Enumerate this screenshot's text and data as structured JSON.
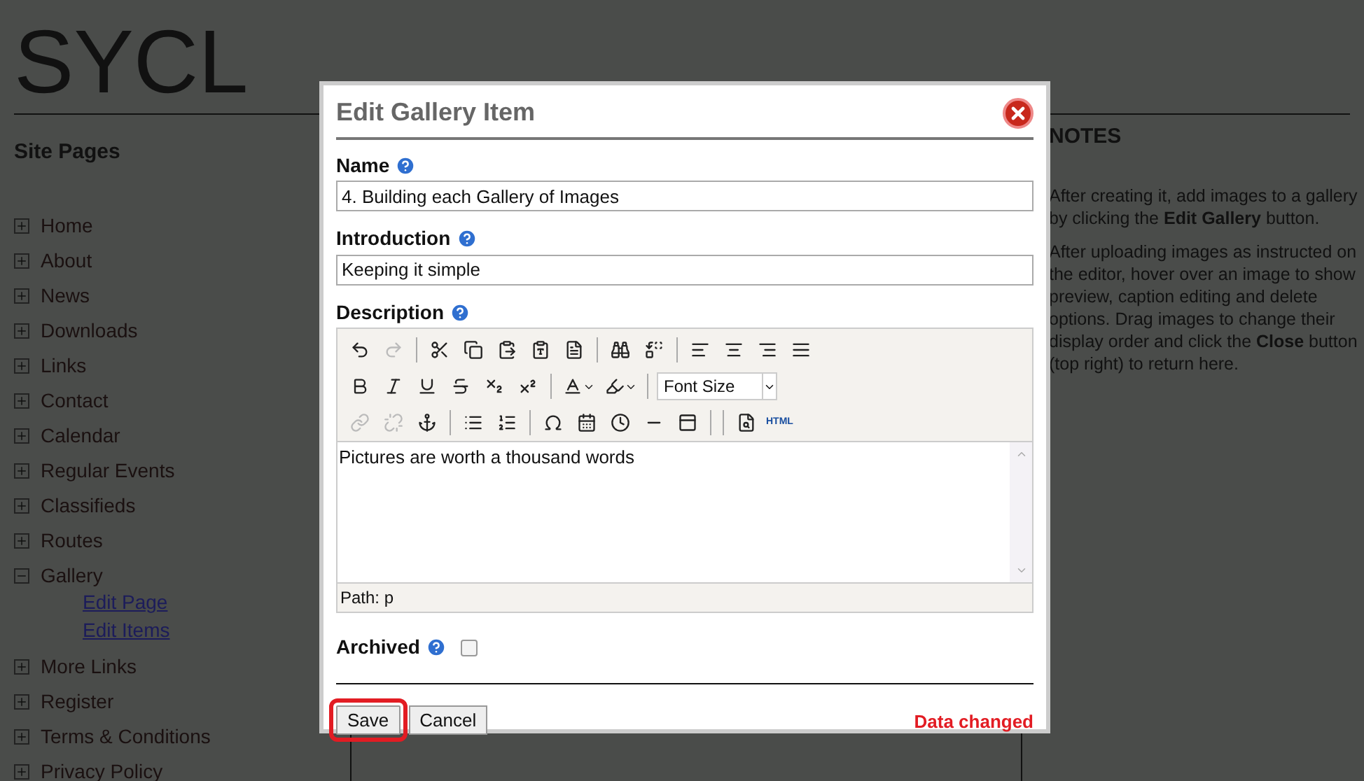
{
  "site_title": "SYCL",
  "sidebar": {
    "heading": "Site Pages",
    "items": [
      {
        "label": "Home",
        "expanded": false
      },
      {
        "label": "About",
        "expanded": false
      },
      {
        "label": "News",
        "expanded": false
      },
      {
        "label": "Downloads",
        "expanded": false
      },
      {
        "label": "Links",
        "expanded": false
      },
      {
        "label": "Contact",
        "expanded": false
      },
      {
        "label": "Calendar",
        "expanded": false
      },
      {
        "label": "Regular Events",
        "expanded": false
      },
      {
        "label": "Classifieds",
        "expanded": false
      },
      {
        "label": "Routes",
        "expanded": false
      },
      {
        "label": "Gallery",
        "expanded": true,
        "children": [
          {
            "label": "Edit Page"
          },
          {
            "label": "Edit Items"
          }
        ]
      },
      {
        "label": "More Links",
        "expanded": false
      },
      {
        "label": "Register",
        "expanded": false
      },
      {
        "label": "Terms & Conditions",
        "expanded": false
      },
      {
        "label": "Privacy Policy",
        "expanded": false
      }
    ]
  },
  "notes": {
    "heading": "NOTES",
    "paragraphs": [
      "After creating it, add images to a gallery by clicking the **Edit Gallery** button.",
      "After uploading images as instructed on the editor, hover over an image to show preview, caption editing and delete options. Drag images to change their display order and click the **Close** button (top right) to return here."
    ]
  },
  "dialog": {
    "title": "Edit Gallery Item",
    "name": {
      "label": "Name",
      "value": "4. Building each Gallery of Images"
    },
    "introduction": {
      "label": "Introduction",
      "value": "Keeping it simple"
    },
    "description": {
      "label": "Description",
      "toolbar": [
        [
          {
            "kind": "button",
            "disabled": false
          },
          {
            "kind": "button",
            "disabled": true
          },
          {
            "kind": "separator"
          },
          {
            "kind": "button",
            "disabled": false
          },
          {
            "kind": "button",
            "disabled": false
          },
          {
            "kind": "button",
            "disabled": false
          },
          {
            "kind": "button",
            "disabled": false
          },
          {
            "kind": "button",
            "disabled": false
          },
          {
            "kind": "separator"
          },
          {
            "kind": "button",
            "disabled": false
          },
          {
            "kind": "button",
            "disabled": false
          },
          {
            "kind": "separator"
          },
          {
            "kind": "button",
            "disabled": false
          },
          {
            "kind": "button",
            "disabled": false
          },
          {
            "kind": "button",
            "disabled": false
          },
          {
            "kind": "button",
            "disabled": false
          }
        ],
        [
          {
            "kind": "button",
            "disabled": false
          },
          {
            "kind": "button",
            "disabled": false
          },
          {
            "kind": "button",
            "disabled": false
          },
          {
            "kind": "button",
            "disabled": false
          },
          {
            "kind": "button",
            "disabled": false
          },
          {
            "kind": "button",
            "disabled": false
          },
          {
            "kind": "separator"
          },
          {
            "kind": "split",
            "disabled": false
          },
          {
            "kind": "split",
            "disabled": false
          },
          {
            "kind": "separator"
          },
          {
            "kind": "select",
            "text": "Font Size"
          }
        ],
        [
          {
            "kind": "button",
            "disabled": true
          },
          {
            "kind": "button",
            "disabled": true
          },
          {
            "kind": "button",
            "disabled": false
          },
          {
            "kind": "separator"
          },
          {
            "kind": "button",
            "disabled": false
          },
          {
            "kind": "button",
            "disabled": false
          },
          {
            "kind": "separator"
          },
          {
            "kind": "button",
            "disabled": false
          },
          {
            "kind": "button",
            "disabled": false
          },
          {
            "kind": "button",
            "disabled": false
          },
          {
            "kind": "button",
            "disabled": false
          },
          {
            "kind": "button",
            "disabled": false
          },
          {
            "kind": "separator"
          },
          {
            "kind": "separator"
          },
          {
            "kind": "button",
            "disabled": false
          },
          {
            "kind": "text",
            "text": "HTML"
          }
        ]
      ],
      "content": "Pictures are worth a thousand words",
      "path": "Path: p"
    },
    "archived": {
      "label": "Archived",
      "checked": false
    },
    "buttons": [
      {
        "label": "Save",
        "circled": true
      },
      {
        "label": "Cancel",
        "circled": false
      }
    ],
    "status": "Data changed"
  }
}
